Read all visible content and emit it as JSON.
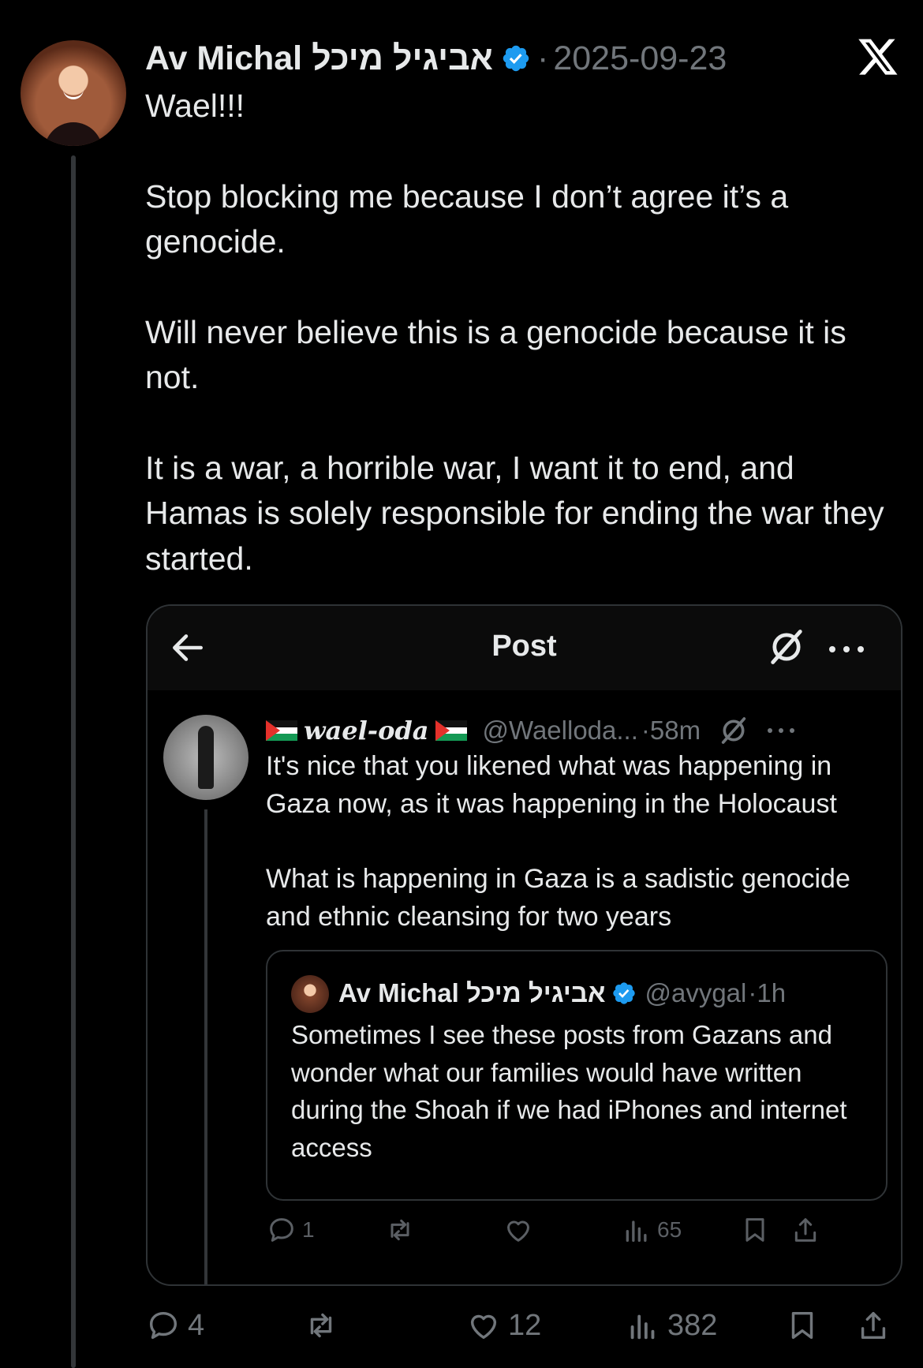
{
  "post": {
    "author_name": "Av Michal אביגיל מיכל",
    "separator": "·",
    "date": "2025-09-23",
    "paragraphs": [
      "Wael!!!",
      "Stop blocking me because I don’t agree it’s a genocide.",
      "Will never believe this is a genocide because it is not.",
      "It is a war, a horrible war, I want it to end, and Hamas is solely responsible for ending the war they started."
    ],
    "stats": {
      "replies": "4",
      "likes": "12",
      "views": "382"
    }
  },
  "screenshot": {
    "nav_title": "Post",
    "reply": {
      "author_name": "wael-oda",
      "handle": "@Waelloda...",
      "time": "·58m",
      "paragraphs": [
        "It's nice that you likened what was happening in Gaza now, as it was happening in the Holocaust",
        "What is happening in Gaza is a sadistic genocide and ethnic cleansing for two years"
      ],
      "stats": {
        "replies": "1",
        "views": "65"
      }
    },
    "quoted": {
      "author_name": "Av Michal אביגיל מיכל",
      "handle": "@avygal",
      "time": "·1h",
      "text": "Sometimes I see these posts from Gazans and wonder what our families would have written during the Shoah if we had iPhones and internet access"
    }
  },
  "icons": {
    "verified": "verified-badge-icon",
    "x_logo": "x-logo-icon",
    "grok": "grok-icon",
    "more": "more-icon",
    "back": "back-arrow-icon",
    "reply": "reply-icon",
    "repost": "repost-icon",
    "like": "like-icon",
    "views": "views-icon",
    "bookmark": "bookmark-icon",
    "share": "share-icon"
  },
  "colors": {
    "background": "#000000",
    "text": "#e7e9ea",
    "secondary_text": "#71767b",
    "verified_blue": "#1d9bf0",
    "border": "#2f3336"
  }
}
